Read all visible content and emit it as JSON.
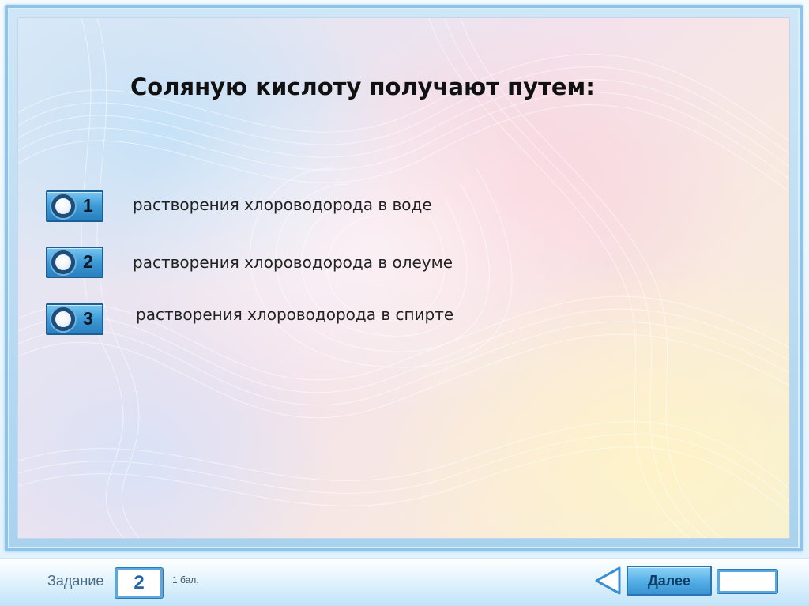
{
  "question": {
    "title": "Соляную кислоту получают путем:"
  },
  "options": [
    {
      "number": "1",
      "text": "растворения хлороводорода в воде"
    },
    {
      "number": "2",
      "text": "растворения хлороводорода в олеуме"
    },
    {
      "number": "3",
      "text": "растворения хлороводорода в спирте"
    }
  ],
  "footer": {
    "task_label": "Задание",
    "task_number": "2",
    "score_label": "1 бал.",
    "next_label": "Далее",
    "answer_value": ""
  },
  "icons": {
    "option_marker": "radio-circle-icon",
    "previous": "triangle-left-icon",
    "background": "swirl-lines-decoration"
  },
  "colors": {
    "accent_blue": "#3c9ad6",
    "frame_blue": "#8cc4ea",
    "title_text": "#111111"
  }
}
